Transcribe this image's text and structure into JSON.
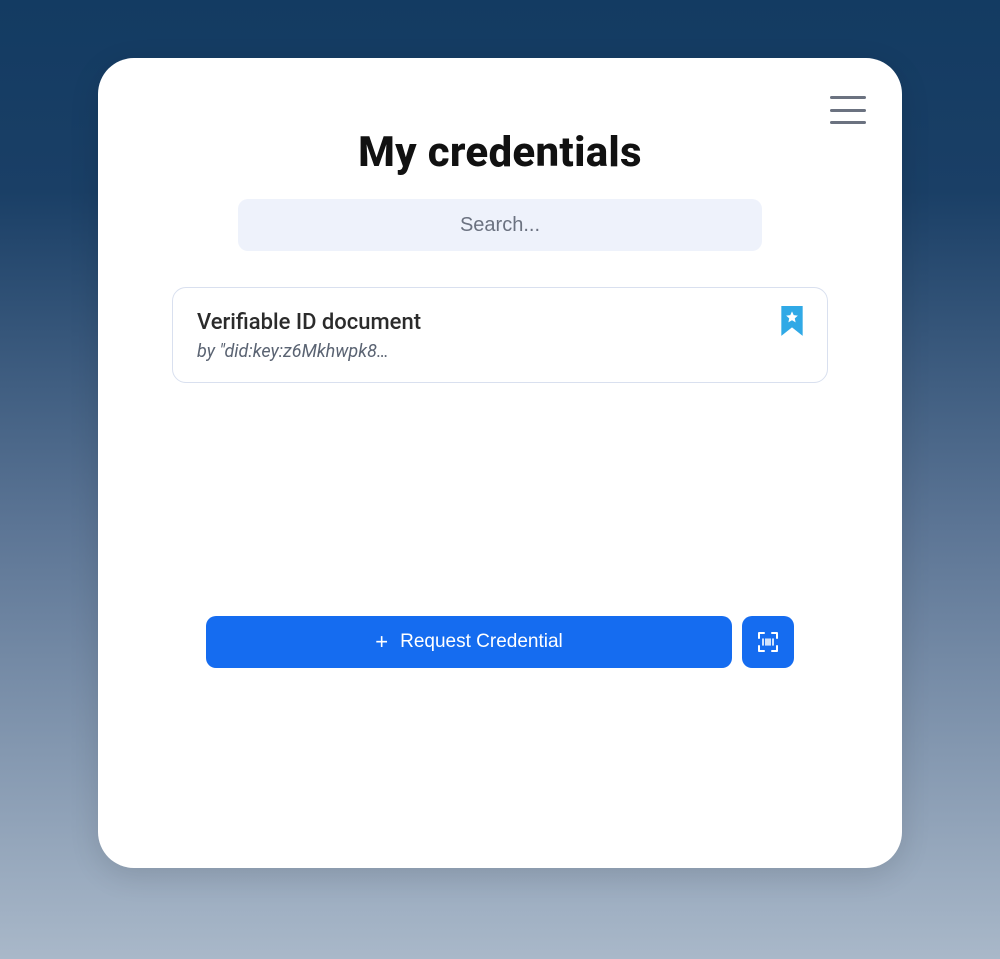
{
  "header": {
    "title": "My credentials"
  },
  "search": {
    "placeholder": "Search...",
    "value": ""
  },
  "credentials": [
    {
      "title": "Verifiable ID document",
      "issuer_line": "by \"did:key:z6Mkhwpk8…",
      "bookmarked": true
    }
  ],
  "actions": {
    "request_label": "Request Credential"
  },
  "icons": {
    "menu": "menu-icon",
    "bookmark": "bookmark-star-icon",
    "plus": "plus-icon",
    "scan": "scan-barcode-icon"
  },
  "colors": {
    "primary": "#156cf0",
    "bookmark": "#30a9e6",
    "search_bg": "#eef2fb"
  }
}
